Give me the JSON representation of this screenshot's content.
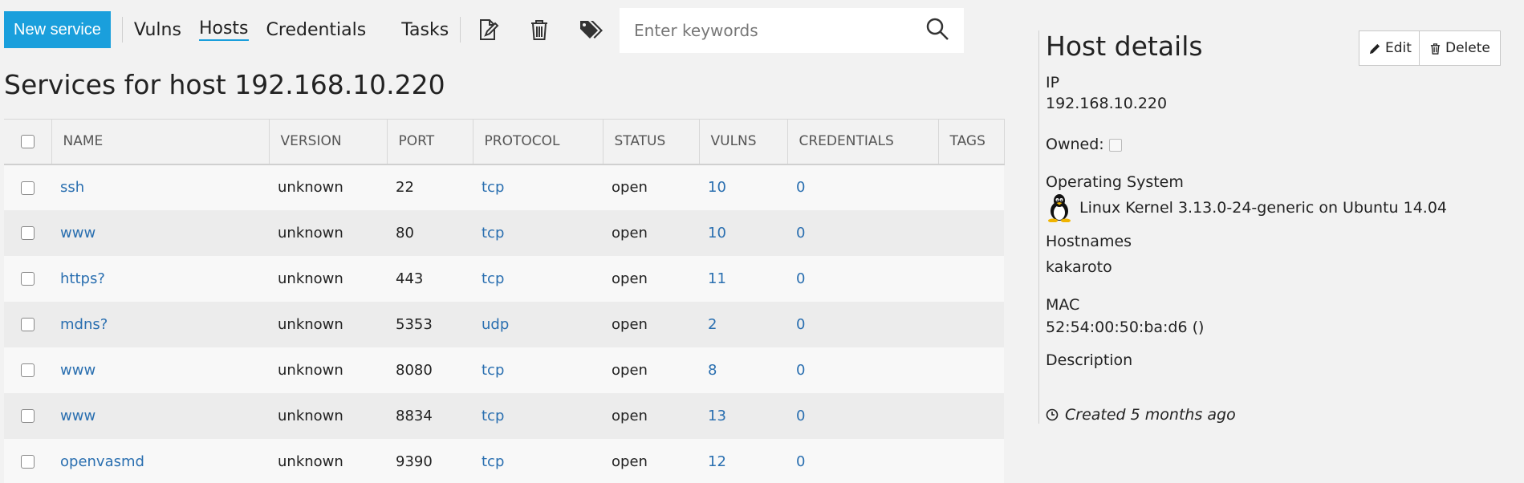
{
  "toolbar": {
    "new_service": "New service",
    "nav": [
      {
        "label": "Vulns",
        "active": false
      },
      {
        "label": "Hosts",
        "active": true
      },
      {
        "label": "Credentials",
        "active": false
      },
      {
        "label": "Tasks",
        "active": false
      }
    ],
    "icons": [
      "edit-note-icon",
      "trash-icon",
      "tags-icon"
    ],
    "search_placeholder": "Enter keywords"
  },
  "page_title": "Services for host 192.168.10.220",
  "table": {
    "columns": [
      "NAME",
      "VERSION",
      "PORT",
      "PROTOCOL",
      "STATUS",
      "VULNS",
      "CREDENTIALS",
      "TAGS"
    ],
    "rows": [
      {
        "name": "ssh",
        "version": "unknown",
        "port": "22",
        "protocol": "tcp",
        "status": "open",
        "vulns": "10",
        "credentials": "0",
        "tags": ""
      },
      {
        "name": "www",
        "version": "unknown",
        "port": "80",
        "protocol": "tcp",
        "status": "open",
        "vulns": "10",
        "credentials": "0",
        "tags": ""
      },
      {
        "name": "https?",
        "version": "unknown",
        "port": "443",
        "protocol": "tcp",
        "status": "open",
        "vulns": "11",
        "credentials": "0",
        "tags": ""
      },
      {
        "name": "mdns?",
        "version": "unknown",
        "port": "5353",
        "protocol": "udp",
        "status": "open",
        "vulns": "2",
        "credentials": "0",
        "tags": ""
      },
      {
        "name": "www",
        "version": "unknown",
        "port": "8080",
        "protocol": "tcp",
        "status": "open",
        "vulns": "8",
        "credentials": "0",
        "tags": ""
      },
      {
        "name": "www",
        "version": "unknown",
        "port": "8834",
        "protocol": "tcp",
        "status": "open",
        "vulns": "13",
        "credentials": "0",
        "tags": ""
      },
      {
        "name": "openvasmd",
        "version": "unknown",
        "port": "9390",
        "protocol": "tcp",
        "status": "open",
        "vulns": "12",
        "credentials": "0",
        "tags": ""
      }
    ]
  },
  "details": {
    "title": "Host details",
    "edit_label": "Edit",
    "delete_label": "Delete",
    "ip_label": "IP",
    "ip_value": "192.168.10.220",
    "owned_label": "Owned:",
    "os_label": "Operating System",
    "os_value": "Linux Kernel 3.13.0-24-generic on Ubuntu 14.04",
    "hostnames_label": "Hostnames",
    "hostnames_value": "kakaroto",
    "mac_label": "MAC",
    "mac_value": "52:54:00:50:ba:d6 ()",
    "description_label": "Description",
    "created": "Created 5 months ago"
  },
  "colors": {
    "accent": "#1a9fdc",
    "link": "#2a6fb0"
  }
}
